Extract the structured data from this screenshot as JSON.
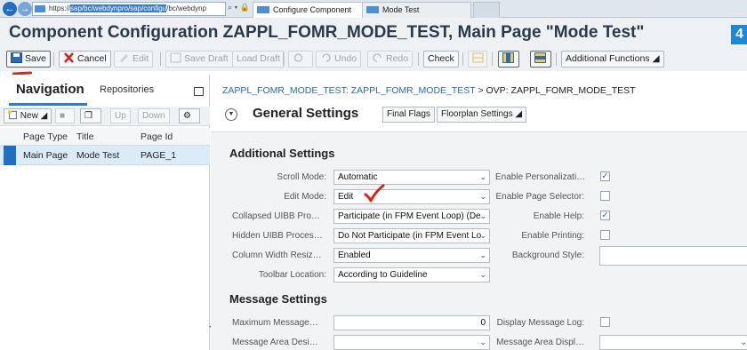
{
  "browser": {
    "url_selected": "sap/bc/webdynpro/sap/configu",
    "url_prefix": "https://",
    "url_rest": "/bc/webdynp",
    "address_icons": "⌕ ▾ 🔒 C",
    "tabs": [
      {
        "label": "Configure Component",
        "active": true
      },
      {
        "label": "Mode Test",
        "active": false
      }
    ]
  },
  "title": "Component Configuration ZAPPL_FOMR_MODE_TEST, Main Page \"Mode Test\"",
  "toolbar": {
    "save": "Save",
    "cancel": "Cancel",
    "edit": "Edit",
    "save_draft": "Save Draft",
    "load_draft": "Load Draft",
    "undo": "Undo",
    "redo": "Redo",
    "check": "Check",
    "additional_functions": "Additional Functions"
  },
  "left_panel": {
    "tab_navigation": "Navigation",
    "tab_repositories": "Repositories",
    "new_button": "New",
    "up_button": "Up",
    "down_button": "Down",
    "columns": [
      "Page Type",
      "Title",
      "Page Id"
    ],
    "rows": [
      {
        "page_type": "Main Page",
        "title": "Mode Test",
        "page_id": "PAGE_1"
      }
    ]
  },
  "main": {
    "breadcrumb_link": "ZAPPL_FOMR_MODE_TEST: ZAPPL_FOMR_MODE_TEST",
    "breadcrumb_sep": " > ",
    "breadcrumb_current": "OVP: ZAPPL_FOMR_MODE_TEST",
    "general_settings": "General Settings",
    "final_flags": "Final Flags",
    "floorplan_settings": "Floorplan Settings",
    "additional_settings": {
      "title": "Additional Settings",
      "fields": {
        "scroll_mode": {
          "label": "Scroll Mode:",
          "value": "Automatic"
        },
        "edit_mode": {
          "label": "Edit Mode:",
          "value": "Edit"
        },
        "collapsed_uibb": {
          "label": "Collapsed UIBB Pro…",
          "value": "Participate (in FPM Event Loop) (De"
        },
        "hidden_uibb": {
          "label": "Hidden UIBB Proces…",
          "value": "Do Not Participate (in FPM Event Lo"
        },
        "column_width": {
          "label": "Column Width Resiz…",
          "value": "Enabled"
        },
        "toolbar_location": {
          "label": "Toolbar Location:",
          "value": "According to Guideline"
        }
      },
      "right_fields": {
        "enable_personalization": {
          "label": "Enable Personalizati…",
          "checked": true
        },
        "enable_page_selector": {
          "label": "Enable Page Selector:",
          "checked": false
        },
        "enable_help": {
          "label": "Enable Help:",
          "checked": true
        },
        "enable_printing": {
          "label": "Enable Printing:",
          "checked": false
        },
        "background_style": {
          "label": "Background Style:",
          "value": ""
        }
      }
    },
    "message_settings": {
      "title": "Message Settings",
      "maximum_message": {
        "label": "Maximum Message…",
        "value": "0"
      },
      "message_area_design": {
        "label": "Message Area Desi…",
        "value": ""
      },
      "display_message_log": {
        "label": "Display Message Log:",
        "checked": false
      },
      "message_area_display": {
        "label": "Message Area Displ…",
        "value": ""
      }
    }
  },
  "colors": {
    "accent": "#2a7fcf",
    "annotation_red": "#d8251b"
  }
}
